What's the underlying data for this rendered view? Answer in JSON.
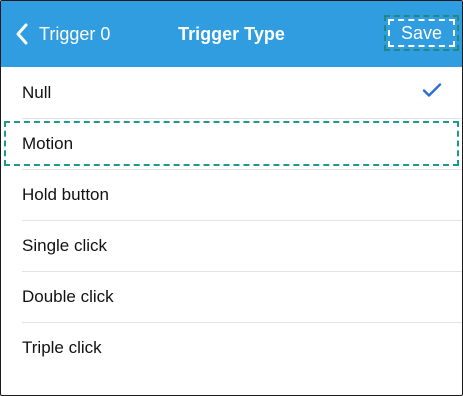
{
  "nav": {
    "back_label": "Trigger 0",
    "title": "Trigger Type",
    "save_label": "Save",
    "color": "#2f9ddf"
  },
  "options": [
    {
      "label": "Null",
      "selected": true
    },
    {
      "label": "Motion",
      "selected": false,
      "highlighted": true
    },
    {
      "label": "Hold button",
      "selected": false
    },
    {
      "label": "Single click",
      "selected": false
    },
    {
      "label": "Double click",
      "selected": false
    },
    {
      "label": "Triple click",
      "selected": false
    }
  ],
  "icons": {
    "back": "chevron-left-icon",
    "selected": "checkmark-icon"
  },
  "check_color": "#2a6fd6"
}
